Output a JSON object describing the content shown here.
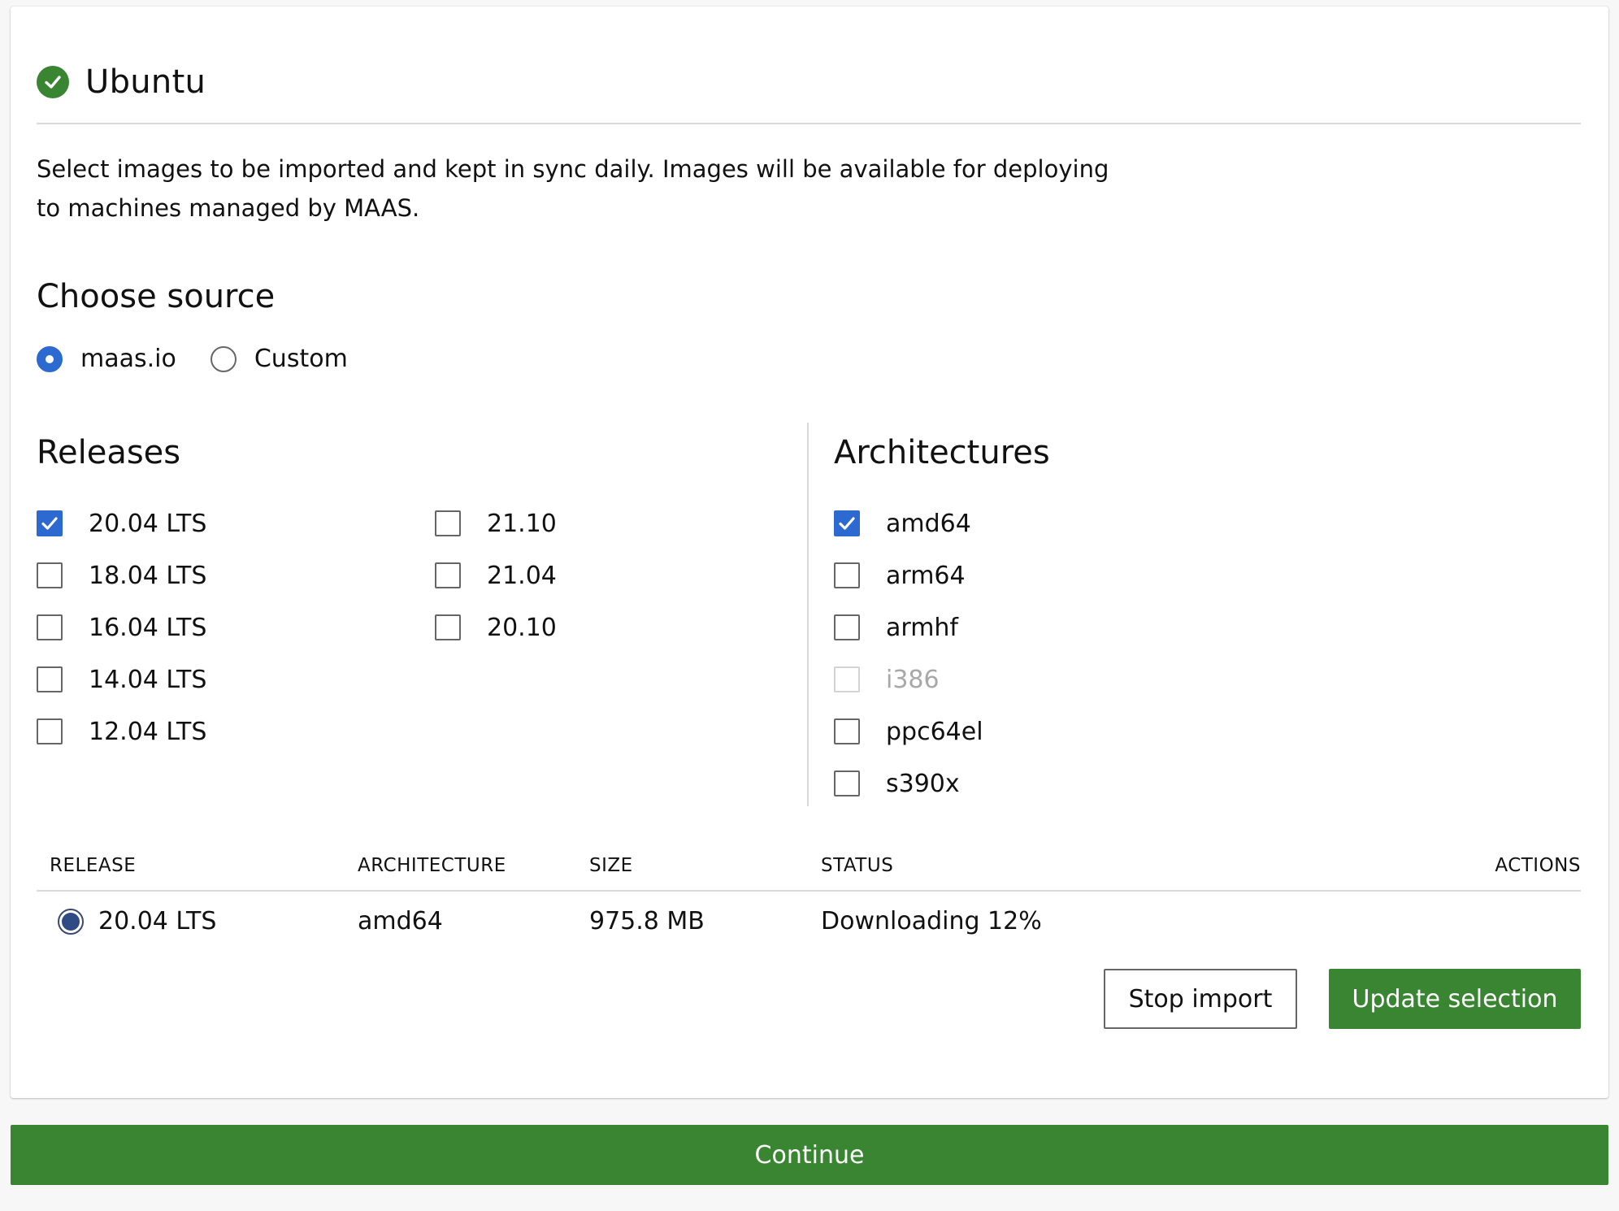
{
  "title": "Ubuntu",
  "description": "Select images to be imported and kept in sync daily. Images will be available for deploying to machines managed by MAAS.",
  "source": {
    "heading": "Choose source",
    "options": [
      {
        "label": "maas.io",
        "checked": true
      },
      {
        "label": "Custom",
        "checked": false
      }
    ]
  },
  "releases": {
    "heading": "Releases",
    "col1": [
      {
        "label": "20.04 LTS",
        "checked": true
      },
      {
        "label": "18.04 LTS",
        "checked": false
      },
      {
        "label": "16.04 LTS",
        "checked": false
      },
      {
        "label": "14.04 LTS",
        "checked": false
      },
      {
        "label": "12.04 LTS",
        "checked": false
      }
    ],
    "col2": [
      {
        "label": "21.10",
        "checked": false
      },
      {
        "label": "21.04",
        "checked": false
      },
      {
        "label": "20.10",
        "checked": false
      }
    ]
  },
  "architectures": {
    "heading": "Architectures",
    "items": [
      {
        "label": "amd64",
        "checked": true,
        "disabled": false
      },
      {
        "label": "arm64",
        "checked": false,
        "disabled": false
      },
      {
        "label": "armhf",
        "checked": false,
        "disabled": false
      },
      {
        "label": "i386",
        "checked": false,
        "disabled": true
      },
      {
        "label": "ppc64el",
        "checked": false,
        "disabled": false
      },
      {
        "label": "s390x",
        "checked": false,
        "disabled": false
      }
    ]
  },
  "table": {
    "headers": {
      "release": "RELEASE",
      "architecture": "ARCHITECTURE",
      "size": "SIZE",
      "status": "STATUS",
      "actions": "ACTIONS"
    },
    "rows": [
      {
        "release": "20.04 LTS",
        "architecture": "amd64",
        "size": "975.8 MB",
        "status": "Downloading 12%"
      }
    ]
  },
  "buttons": {
    "stop_import": "Stop import",
    "update_selection": "Update selection",
    "continue": "Continue"
  },
  "colors": {
    "positive": "#3a8532",
    "accent": "#2c6ad1"
  },
  "icons": {
    "title_status": "check-circle-icon",
    "checkbox_checked": "checkmark-icon"
  }
}
